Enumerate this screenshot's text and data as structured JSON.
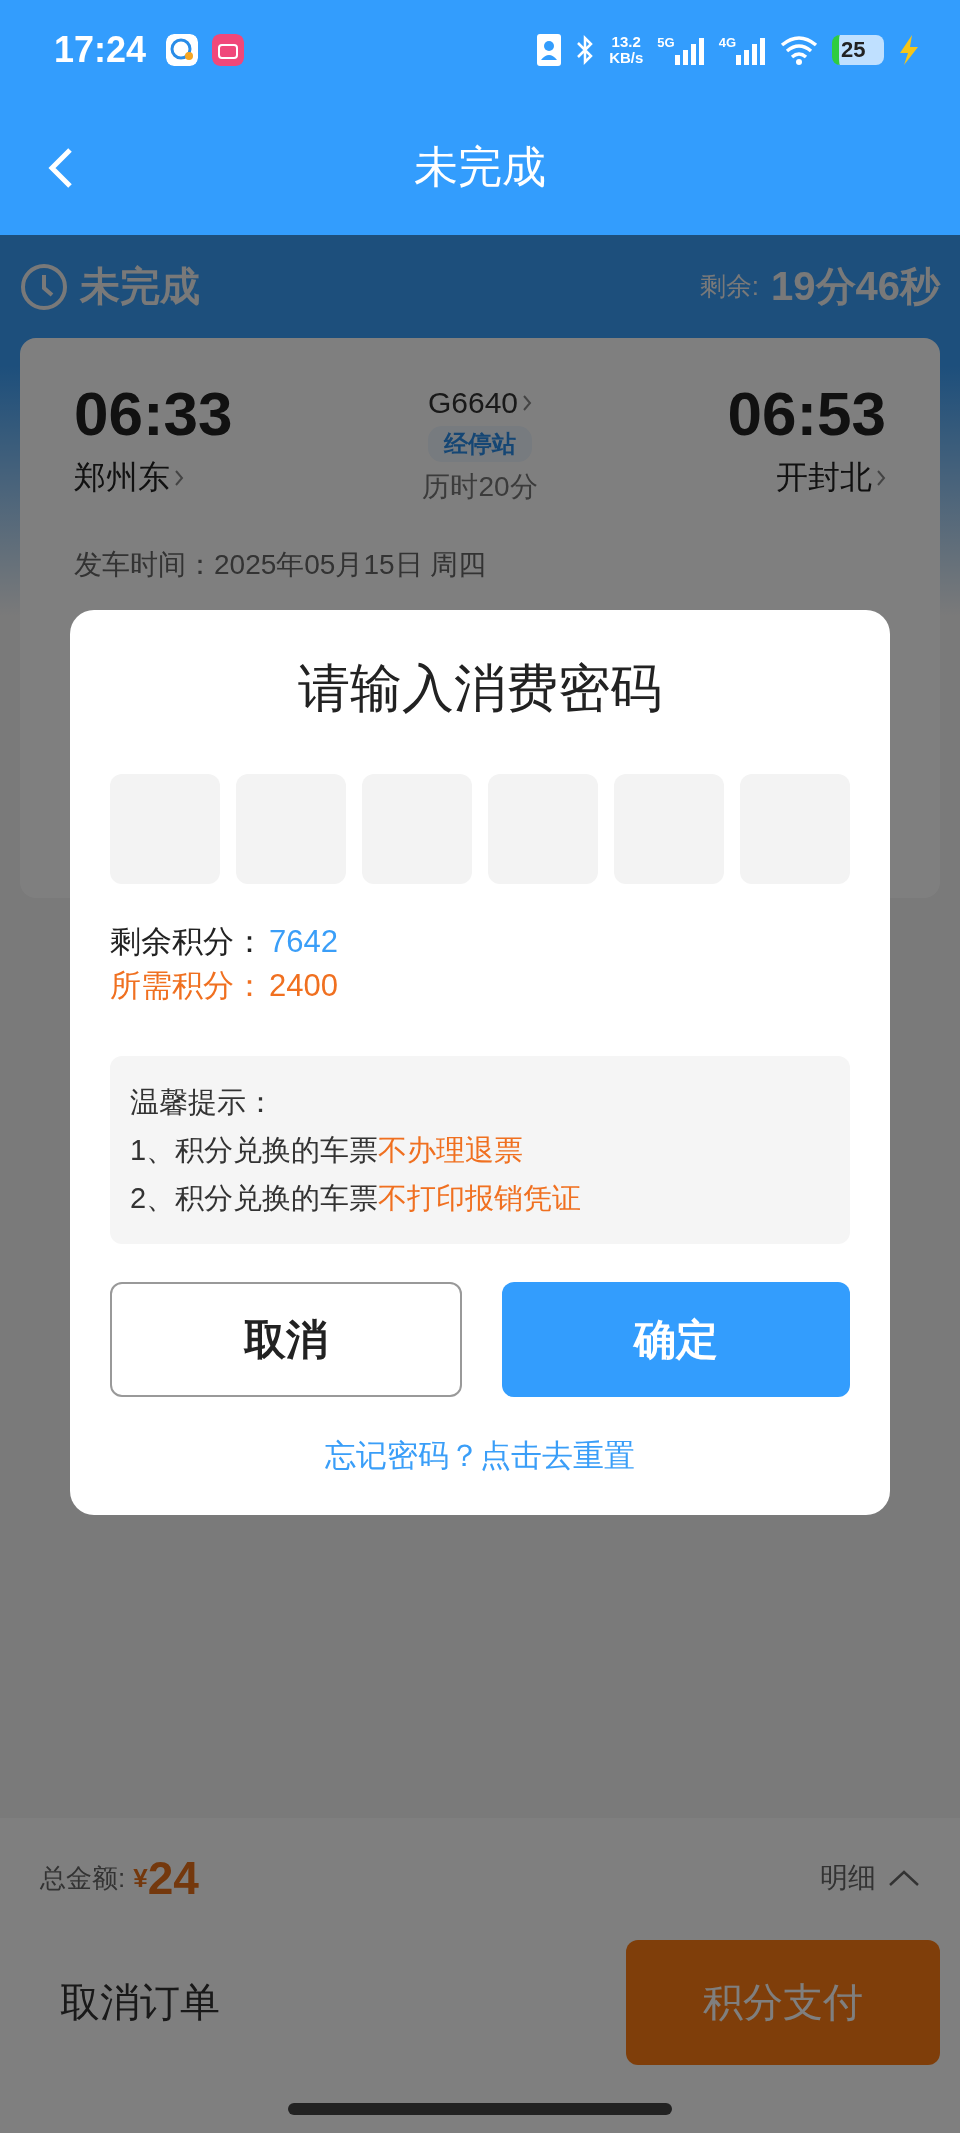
{
  "status_bar": {
    "time": "17:24",
    "network_speed": "13.2",
    "network_speed_unit": "KB/s",
    "networks": [
      "5G",
      "4G"
    ],
    "battery": "25"
  },
  "header": {
    "title": "未完成"
  },
  "order_status": {
    "label": "未完成",
    "remaining_label": "剩余:",
    "remaining_time": "19分46秒"
  },
  "trip": {
    "depart_time": "06:33",
    "depart_station": "郑州东",
    "train_no": "G6640",
    "stops_label": "经停站",
    "duration": "历时20分",
    "arrive_time": "06:53",
    "arrive_station": "开封北",
    "departure_date": "发车时间：2025年05月15日 周四"
  },
  "dialog": {
    "title": "请输入消费密码",
    "pin_fields": [
      {
        "filled": false
      },
      {
        "filled": false
      },
      {
        "filled": false
      },
      {
        "filled": false
      },
      {
        "filled": false
      },
      {
        "filled": false
      }
    ],
    "points": [
      {
        "kind": "balance",
        "label": "剩余积分：",
        "value": "7642"
      },
      {
        "kind": "required",
        "label": "所需积分：",
        "value": "2400"
      }
    ],
    "notice": {
      "title": "温馨提示：",
      "lines": [
        {
          "text": "1、积分兑换的车票",
          "highlight": "不办理退票"
        },
        {
          "text": "2、积分兑换的车票",
          "highlight": "不打印报销凭证"
        }
      ]
    },
    "buttons": [
      {
        "kind": "secondary",
        "label": "取消"
      },
      {
        "kind": "primary",
        "label": "确定"
      }
    ],
    "reset_link": "忘记密码？点击去重置"
  },
  "footer": {
    "total_label": "总金额:",
    "currency": "¥",
    "amount": "24",
    "details": "明细",
    "cancel": "取消订单",
    "pay": "积分支付"
  }
}
